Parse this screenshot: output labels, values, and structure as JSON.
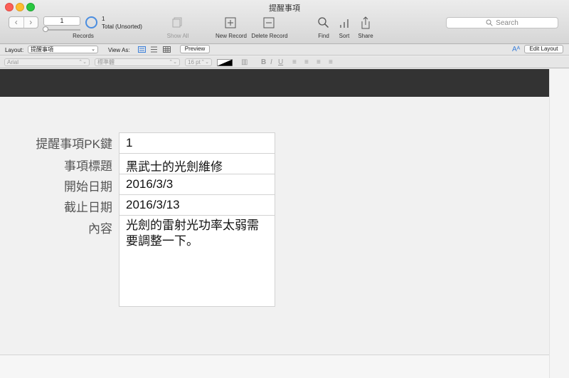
{
  "window": {
    "title": "提醒事項"
  },
  "toolbar": {
    "current_record": "1",
    "records_label": "Records",
    "found_count": "1",
    "total_label": "Total (Unsorted)",
    "show_all": "Show All",
    "new_record": "New Record",
    "delete_record": "Delete Record",
    "find": "Find",
    "sort": "Sort",
    "share": "Share",
    "search_placeholder": "Search"
  },
  "layoutbar": {
    "layout_label": "Layout:",
    "layout_value": "提醒事項",
    "view_as_label": "View As:",
    "preview": "Preview",
    "edit_layout": "Edit Layout"
  },
  "formatbar": {
    "font": "Arial",
    "style": "標準體",
    "size": "16 pt"
  },
  "record": {
    "fields": [
      {
        "label": "提醒事項PK鍵",
        "value": "1"
      },
      {
        "label": "事項標題",
        "value": "黑武士的光劍維修"
      },
      {
        "label": "開始日期",
        "value": "2016/3/3"
      },
      {
        "label": "截止日期",
        "value": "2016/3/13"
      },
      {
        "label": "內容",
        "value": "光劍的雷射光功率太弱需要調整一下。"
      }
    ]
  },
  "colors": {
    "header_band": "#333333",
    "progress_ring": "#4a8de0",
    "active_view": "#3b7fd9"
  }
}
